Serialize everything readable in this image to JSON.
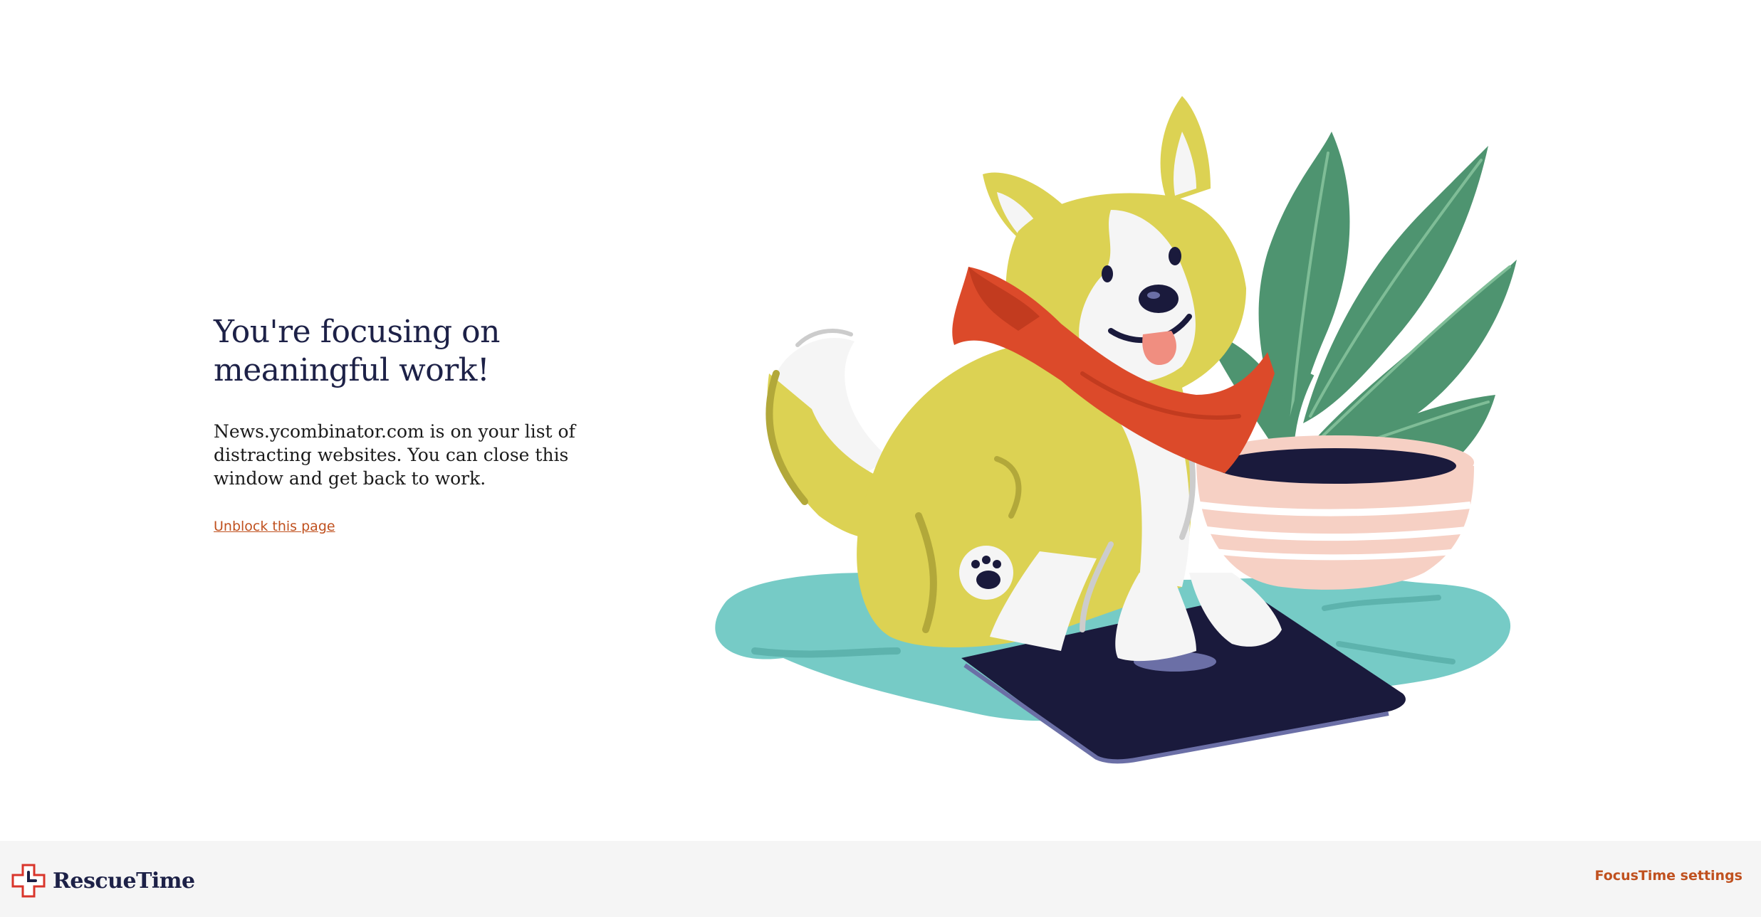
{
  "main": {
    "headline": "You're focusing on meaningful work!",
    "message": "News.ycombinator.com is on your list of distracting websites. You can close this window and get back to work.",
    "unblock_label": "Unblock this page",
    "illustration": "corgi-on-scale-illustration"
  },
  "footer": {
    "logo_text": "RescueTime",
    "logo_icon": "rescuetime-cross-clock-icon",
    "settings_label": "FocusTime settings"
  },
  "colors": {
    "headline": "#1d2147",
    "accent": "#c0511f",
    "footer_bg": "#f5f5f5",
    "dog_yellow": "#dcd253",
    "bandana_red": "#dc4a2a",
    "floor_teal": "#76cbc6",
    "scale_navy": "#1a1a3c",
    "leaf_green": "#4e9470",
    "pot_pink": "#f6d0c4"
  }
}
